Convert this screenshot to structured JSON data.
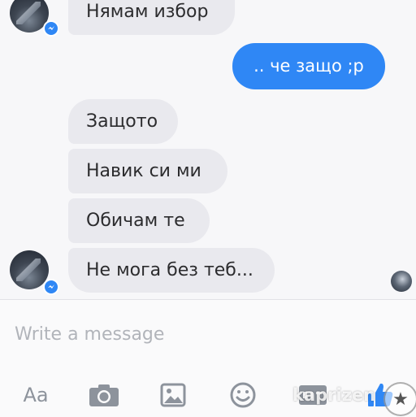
{
  "messages": [
    {
      "text": "Нямам избор",
      "direction": "incoming"
    },
    {
      "text": ".. че защо ;р",
      "direction": "outgoing"
    },
    {
      "text": "Защото",
      "direction": "incoming"
    },
    {
      "text": "Навик си ми",
      "direction": "incoming"
    },
    {
      "text": "Обичам те",
      "direction": "incoming"
    },
    {
      "text": "Не мога без теб...",
      "direction": "incoming"
    }
  ],
  "composer": {
    "placeholder": "Write a message",
    "tools": {
      "text_label": "Aa",
      "camera_icon": "camera-icon",
      "image_icon": "image-icon",
      "emoji_icon": "emoji-icon",
      "gif_icon": "gif-icon",
      "like_icon": "thumbs-up-icon"
    }
  },
  "watermark": {
    "text": "kaprizen"
  },
  "colors": {
    "outgoing_bubble": "#2f87f5",
    "incoming_bubble": "#e9e9ee",
    "icon_gray": "#8d939c",
    "like_blue": "#2f87f5",
    "background": "#f7f7f9"
  }
}
